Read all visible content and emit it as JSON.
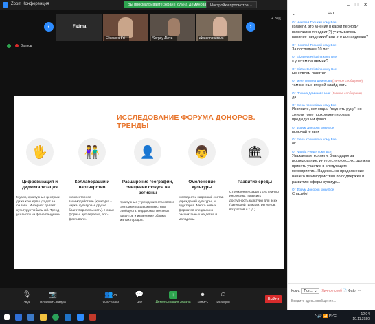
{
  "window": {
    "title": "Zoom Конференция"
  },
  "banner": {
    "viewing": "Вы просматриваете экран Полина Деминова",
    "options": "Настройки просмотра ⌄"
  },
  "thumbnails": [
    {
      "name": "Fatima",
      "bg": "#2a2a2a"
    },
    {
      "name": "Elizaveta Kri...",
      "bg": "#6b4a3a"
    },
    {
      "name": "Sergey Alexe...",
      "bg": "#5a5048"
    },
    {
      "name": "ekaterinavereva...",
      "bg": "#7a6a5a"
    }
  ],
  "view_label": "⊞ Вид",
  "recording_label": "Запись",
  "slide": {
    "title": "ИССЛЕДОВАНИЕ ФОРУМА ДОНОРОВ. ТРЕНДЫ",
    "columns": [
      {
        "icon": "🖐",
        "heading": "Цифровизация и диджитализация",
        "body": "Музеи, культурные центры и даже концерты уходят за онлайн. Интернет делает культуру глобальной. Тренд усилился на фоне пандемии."
      },
      {
        "icon": "👫",
        "heading": "Коллаборации и партнерство",
        "body": "Межсекторное взаимодействие (культура + наука, культура + другие благотворительность). Новые формы: арт-терапия, арт-фестивали."
      },
      {
        "icon": "👤",
        "heading": "Расширение географии, смещение фокуса на регионы",
        "body": "Культурные учреждения становятся центрами поддержки местных сообществ. Поддержка местных талантов и изменение облика малых городов."
      },
      {
        "icon": "👨",
        "heading": "Омоложение культуры",
        "body": "Молодеет и кадровый состав учреждений культуры, и аудитория. Много новых форматов специально рассчитанных на детей и молодежь."
      },
      {
        "icon": "🏛",
        "heading": "Развитие среды",
        "body": "Стремление создать системную инклюзию, повысить доступность культуры для всех (категорий граждан, регионов, возрастов и т. д.)"
      }
    ]
  },
  "toolbar": {
    "mic": "Звук",
    "video": "Включить видео",
    "participants": "Участники",
    "participants_count": "28",
    "chat": "Чат",
    "share": "Демонстрация экрана",
    "record": "Запись",
    "reactions": "Реакции",
    "leave": "Выйти"
  },
  "chat": {
    "title": "Чат",
    "messages": [
      {
        "from": "От Николай Троцкий кому Все:",
        "text": "коллеги, это мнения в какой период? включился ли сдвиг(?) учитывалось влияние пандемии? или это до пандемии?",
        "private": ""
      },
      {
        "from": "От Николай Троцкий кому Все:",
        "text": "За последние 10 лет",
        "private": ""
      },
      {
        "from": "От Elizaveta Kristkina кому Все:",
        "text": "с учетом пандемии?",
        "private": ""
      },
      {
        "from": "От Elizaveta Kristkina кому Все:",
        "text": "Не совсем понятно",
        "private": ""
      },
      {
        "from": "От меня Полина Деминова",
        "text": "там же еще второй слайд есть",
        "private": "(Личное сообщение)"
      },
      {
        "from": "От Полина Деминова мне:",
        "text": "да",
        "private": "(Личное сообщение)"
      },
      {
        "from": "От Elena Konovalova кому Все:",
        "text": "Извините, нет опции \"поднять руку\", но хотели тоже прокомментировать предыдущий файл",
        "private": ""
      },
      {
        "from": "От Форум Доноров кому Все:",
        "text": "включайте звук",
        "private": ""
      },
      {
        "from": "От Elena Konovalova кому Все:",
        "text": "ок",
        "private": ""
      },
      {
        "from": "От Natalia Peppel кому Все:",
        "text": "Уважаемые коллеги, благодарю за исследование, интересную сессию, должна принять участие в следующем мероприятии. Надеюсь на продолжение нашего взаимодействия по поддержке и развитию сферы культуры.",
        "private": ""
      },
      {
        "from": "От Форум Доноров кому Все:",
        "text": "Спасибо!",
        "private": ""
      }
    ],
    "to_label": "Кому:",
    "to_value": "Пол... ⌄",
    "to_private": "(Личное сооб",
    "file_label": "Файл",
    "input_placeholder": "Введите здесь сообщение..."
  },
  "taskbar": {
    "tray_misc": "^ 🔊 📶 РУС",
    "time": "12:04",
    "date": "10.11.2020"
  }
}
